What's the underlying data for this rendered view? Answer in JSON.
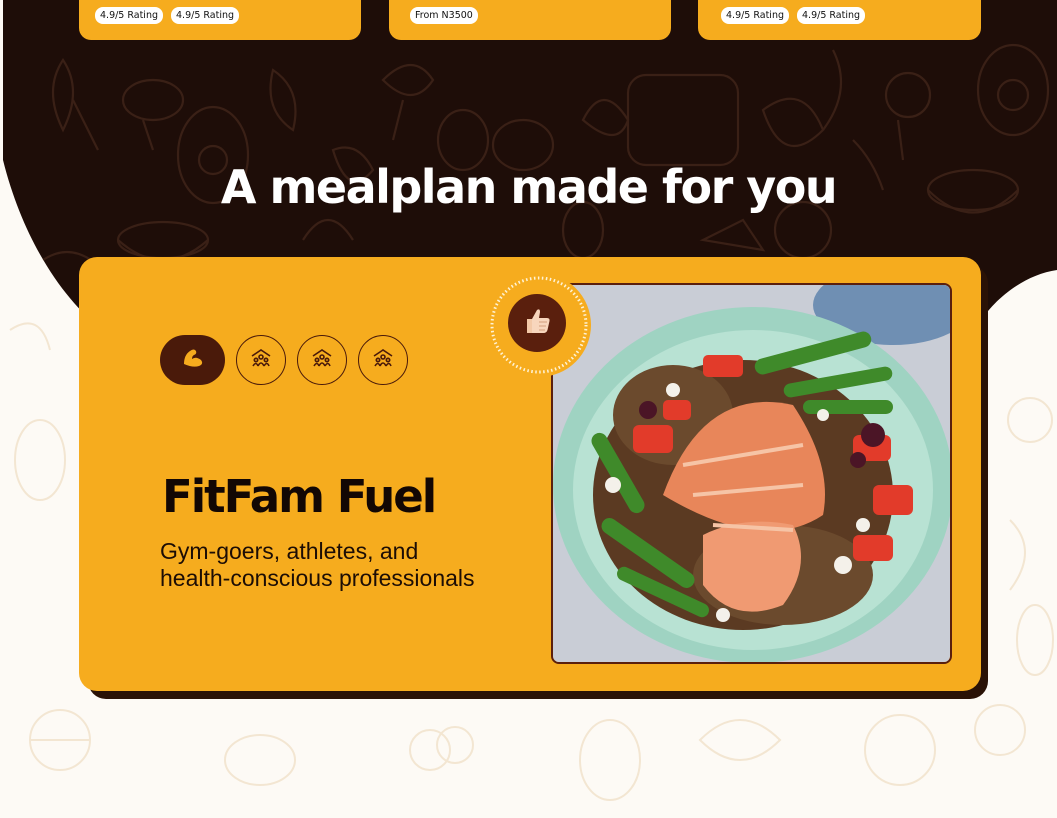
{
  "top_cards": [
    {
      "badges": [
        "4.9/5 Rating",
        "4.9/5 Rating"
      ]
    },
    {
      "badges": [
        "From N3500"
      ]
    },
    {
      "badges": [
        "4.9/5 Rating",
        "4.9/5 Rating"
      ]
    }
  ],
  "section": {
    "heading": "A mealplan made for you"
  },
  "mealplan": {
    "title": "FitFam Fuel",
    "description": "Gym-goers, athletes, and health-conscious professionals",
    "category_icons": [
      "flexed-biceps-icon",
      "group-icon",
      "group-icon",
      "group-icon"
    ],
    "active_category": 0,
    "reaction_icon": "thumbs-up-icon",
    "image": "salmon-quinoa-bowl"
  },
  "colors": {
    "dark_brown": "#1e0d08",
    "accent_orange": "#f6ac1e",
    "deep_brown": "#4a1a0a",
    "cream": "#fdfaf5",
    "white": "#ffffff"
  }
}
